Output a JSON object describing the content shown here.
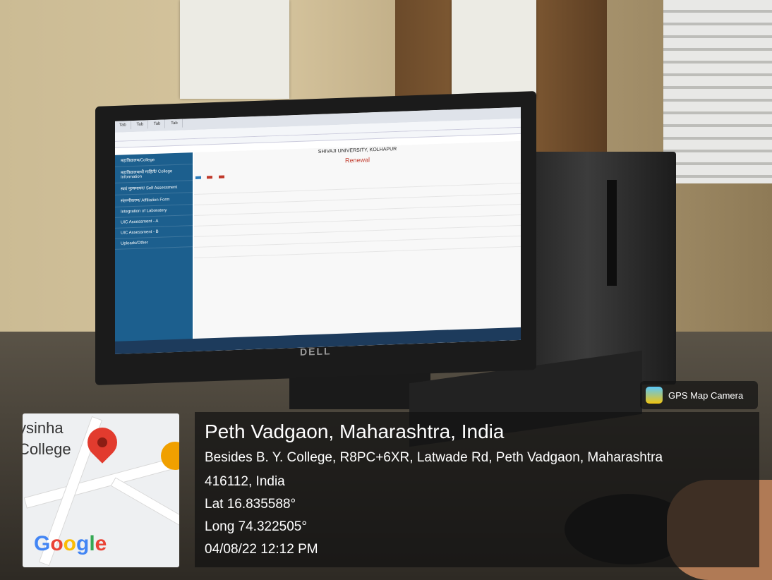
{
  "badge": {
    "label": "GPS Map Camera"
  },
  "location": {
    "city": "Peth Vadgaon, Maharashtra, India",
    "address_line1": "Besides B. Y. College, R8PC+6XR, Latwade Rd, Peth Vadgaon, Maharashtra",
    "address_line2": "416112, India",
    "lat": "Lat 16.835588°",
    "long": "Long 74.322505°",
    "datetime": "04/08/22 12:12 PM"
  },
  "map": {
    "label_top": "ysinha",
    "label_bottom": "College",
    "brand": "Google"
  },
  "monitor": {
    "brand": "DELL",
    "university": "SHIVAJI UNIVERSITY, KOLHAPUR",
    "page_heading": "Renewal",
    "sidebar_items": [
      "महाविद्यालय/College",
      "महाविद्यालयाची माहिती/ College Information",
      "स्वयं मूल्यमापन/ Self Assessment",
      "संलग्नीकरण/ Affiliation Form",
      "Integration of Laboratory",
      "UIC Assessment - A",
      "UIC Assessment - B",
      "Uploads/Other"
    ]
  },
  "colors": {
    "sidebar": "#1c5f8e",
    "badge_bg": "#141414",
    "accent_red": "#c0392b"
  }
}
